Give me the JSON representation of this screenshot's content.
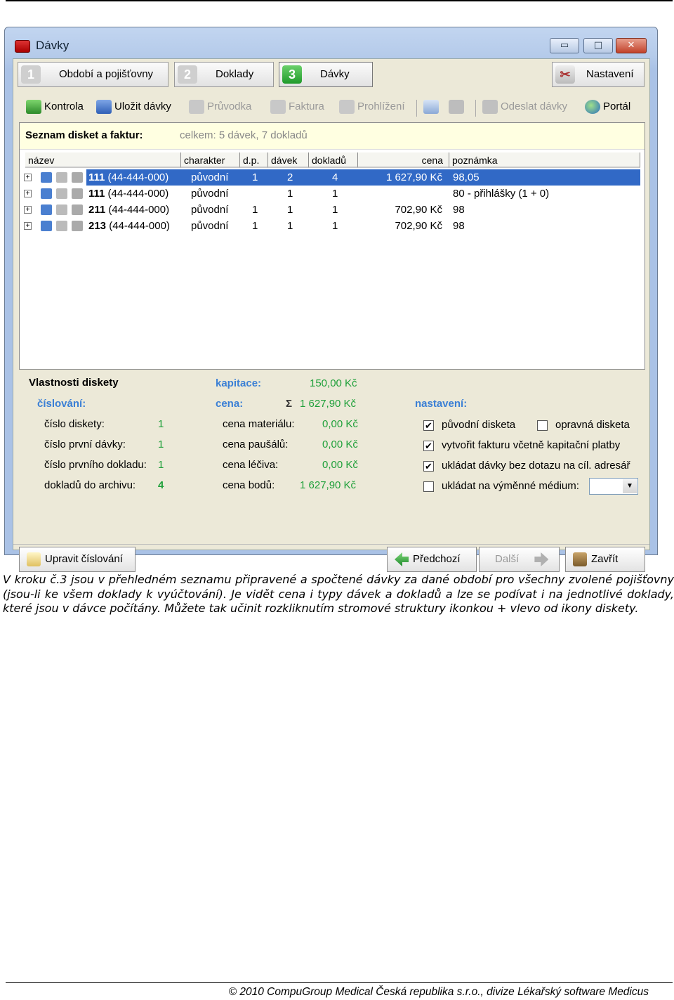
{
  "window": {
    "title": "Dávky",
    "min": "▭",
    "max": "□",
    "close": "✕"
  },
  "steps": [
    {
      "num": "1",
      "label": "Období a pojišťovny"
    },
    {
      "num": "2",
      "label": "Doklady"
    },
    {
      "num": "3",
      "label": "Dávky"
    }
  ],
  "settings_button": "Nastavení",
  "toolbar": {
    "kontrola": "Kontrola",
    "ulozit": "Uložit dávky",
    "pruvodka": "Průvodka",
    "faktura": "Faktura",
    "prohlizeni": "Prohlížení",
    "odeslat": "Odeslat dávky",
    "portal": "Portál"
  },
  "list": {
    "title": "Seznam disket a faktur:",
    "summary": "celkem: 5 dávek, 7 dokladů",
    "columns": [
      "název",
      "charakter",
      "d.p.",
      "dávek",
      "dokladů",
      "cena",
      "poznámka"
    ],
    "rows": [
      {
        "name_bold": "111",
        "name_code": "(44-444-000)",
        "charakter": "původní",
        "dp": "1",
        "davek": "2",
        "dokladu": "4",
        "cena": "1 627,90 Kč",
        "poznamka": "98,05"
      },
      {
        "name_bold": "111",
        "name_code": "(44-444-000)",
        "charakter": "původní",
        "dp": "",
        "davek": "1",
        "dokladu": "1",
        "cena": "",
        "poznamka": "80 - přihlášky (1 + 0)"
      },
      {
        "name_bold": "211",
        "name_code": "(44-444-000)",
        "charakter": "původní",
        "dp": "1",
        "davek": "1",
        "dokladu": "1",
        "cena": "702,90 Kč",
        "poznamka": "98"
      },
      {
        "name_bold": "213",
        "name_code": "(44-444-000)",
        "charakter": "původní",
        "dp": "1",
        "davek": "1",
        "dokladu": "1",
        "cena": "702,90 Kč",
        "poznamka": "98"
      }
    ]
  },
  "props": {
    "title": "Vlastnosti diskety",
    "cislovani": "číslování:",
    "cislo_diskety_l": "číslo diskety:",
    "cislo_diskety_v": "1",
    "cislo_prvni_davky_l": "číslo první dávky:",
    "cislo_prvni_davky_v": "1",
    "cislo_prvniho_dokladu_l": "číslo prvního dokladu:",
    "cislo_prvniho_dokladu_v": "1",
    "dokladu_do_archivu_l": "dokladů do archivu:",
    "dokladu_do_archivu_v": "4",
    "kapitace_l": "kapitace:",
    "kapitace_v": "150,00 Kč",
    "cena_l": "cena:",
    "sigma": "Σ",
    "cena_v": "1 627,90 Kč",
    "cena_materialu_l": "cena materiálu:",
    "cena_materialu_v": "0,00 Kč",
    "cena_pausalu_l": "cena paušálů:",
    "cena_pausalu_v": "0,00 Kč",
    "cena_leciva_l": "cena léčiva:",
    "cena_leciva_v": "0,00 Kč",
    "cena_bodu_l": "cena bodů:",
    "cena_bodu_v": "1 627,90 Kč",
    "nastaveni": "nastavení:",
    "puvodni_disketa": "původní disketa",
    "opravna_disketa": "opravná disketa",
    "vytvorit_fakturu": "vytvořit fakturu včetně kapitační platby",
    "ukladat_davky": "ukládat dávky bez dotazu na cíl. adresář",
    "ukladat_medium": "ukládat na výměnné médium:"
  },
  "buttons": {
    "upravit": "Upravit číslování",
    "predchozi": "Předchozí",
    "dalsi": "Další",
    "zavrit": "Zavřít"
  },
  "caption": "V kroku č.3 jsou v přehledném seznamu připravené a spočtené dávky za dané období pro všechny zvolené pojišťovny (jsou-li ke všem doklady k vyúčtování). Je vidět cena i typy dávek a dokladů a lze se podívat i na jednotlivé doklady, které jsou v dávce počítány. Můžete tak učinit rozkliknutím stromové struktury ikonkou + vlevo od ikony diskety.",
  "footer": "© 2010 CompuGroup Medical Česká republika s.r.o., divize Lékařský software Medicus"
}
